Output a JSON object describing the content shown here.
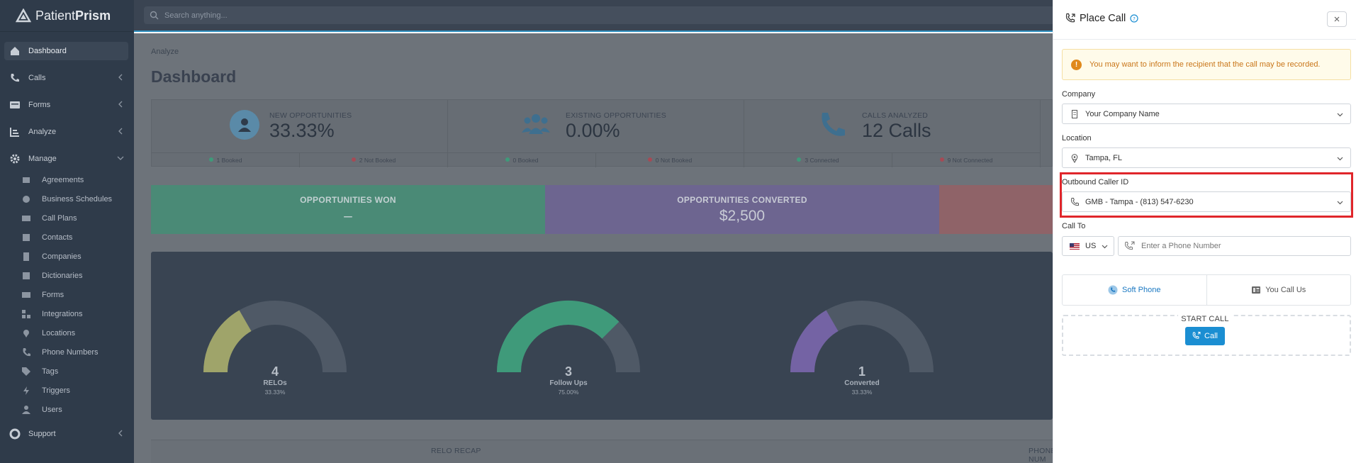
{
  "brand": {
    "name_a": "Patient",
    "name_b": "Prism"
  },
  "search": {
    "placeholder": "Search anything..."
  },
  "sidebar": {
    "items": [
      {
        "label": "Dashboard",
        "icon": "home-icon"
      },
      {
        "label": "Calls",
        "icon": "phone-icon"
      },
      {
        "label": "Forms",
        "icon": "form-icon"
      },
      {
        "label": "Analyze",
        "icon": "analyze-icon"
      },
      {
        "label": "Manage",
        "icon": "gear-icon"
      },
      {
        "label": "Support",
        "icon": "support-icon"
      }
    ],
    "manage_items": [
      "Agreements",
      "Business Schedules",
      "Call Plans",
      "Contacts",
      "Companies",
      "Dictionaries",
      "Forms",
      "Integrations",
      "Locations",
      "Phone Numbers",
      "Tags",
      "Triggers",
      "Users"
    ]
  },
  "main": {
    "breadcrumb": "Analyze",
    "title": "Dashboard",
    "stats": [
      {
        "label": "NEW OPPORTUNITIES",
        "value": "33.33%",
        "foot": [
          "1 Booked",
          "2 Not Booked"
        ]
      },
      {
        "label": "EXISTING OPPORTUNITIES",
        "value": "0.00%",
        "foot": [
          "0 Booked",
          "0 Not Booked"
        ]
      },
      {
        "label": "CALLS ANALYZED",
        "value": "12 Calls",
        "foot": [
          "3 Connected",
          "9 Not Connected"
        ]
      }
    ],
    "bands": [
      {
        "title": "OPPORTUNITIES WON",
        "value": "–",
        "color": "#4fa287"
      },
      {
        "title": "OPPORTUNITIES CONVERTED",
        "value": "$2,500",
        "color": "#7d6fa8"
      },
      {
        "title": "",
        "value": "",
        "color": "#a86d74"
      }
    ],
    "gauges": [
      {
        "num": "4",
        "name": "RELOs",
        "pct": "33.33%",
        "fraction": 0.3333,
        "color": "#9fa46a"
      },
      {
        "num": "3",
        "name": "Follow Ups",
        "pct": "75.00%",
        "fraction": 0.75,
        "color": "#3f9a7a"
      },
      {
        "num": "1",
        "name": "Converted",
        "pct": "33.33%",
        "fraction": 0.3333,
        "color": "#7463a4"
      }
    ],
    "recap": [
      "RELO RECAP",
      "PHONE NUM"
    ]
  },
  "panel": {
    "title": "Place Call",
    "alert": "You may want to inform the recipient that the call may be recorded.",
    "company_label": "Company",
    "company_value": "Your Company Name",
    "location_label": "Location",
    "location_value": "Tampa, FL",
    "caller_id_label": "Outbound Caller ID",
    "caller_id_value": "GMB - Tampa - (813) 547-6230",
    "call_to_label": "Call To",
    "country_code": "US",
    "phone_placeholder": "Enter a Phone Number",
    "tabs": [
      "Soft Phone",
      "You Call Us"
    ],
    "start_call": "START CALL",
    "call_button": "Call"
  },
  "colors": {
    "accent": "#1b8ed2",
    "highlight": "#e0262b",
    "alert_text": "#c9761a"
  }
}
